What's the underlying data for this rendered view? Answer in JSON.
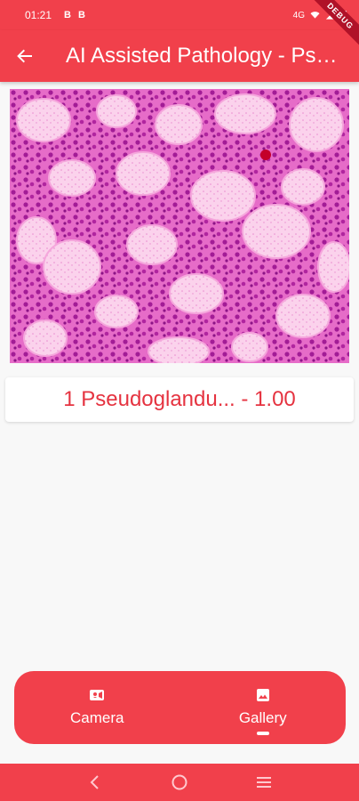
{
  "status_bar": {
    "time": "01:21",
    "notifications": [
      "B",
      "B"
    ],
    "network": "4G",
    "icons": [
      "wifi-icon",
      "signal-icon",
      "battery-icon"
    ]
  },
  "debug_banner": "DEBUG",
  "app_bar": {
    "title": "AI Assisted Pathology - Pseudoglandular",
    "back_icon": "arrow-back-icon"
  },
  "image": {
    "description_icon": "pathology-slide-image"
  },
  "result": {
    "label": "1 Pseudoglandu... - 1.00"
  },
  "bottom_nav": {
    "items": [
      {
        "label": "Camera",
        "icon": "videocam-icon",
        "selected": false
      },
      {
        "label": "Gallery",
        "icon": "image-icon",
        "selected": true
      }
    ]
  },
  "system_nav": {
    "buttons": [
      "back-icon",
      "home-icon",
      "menu-icon"
    ]
  },
  "colors": {
    "primary": "#f1404b",
    "result_text": "#e53340",
    "background": "#f8f8f8"
  }
}
